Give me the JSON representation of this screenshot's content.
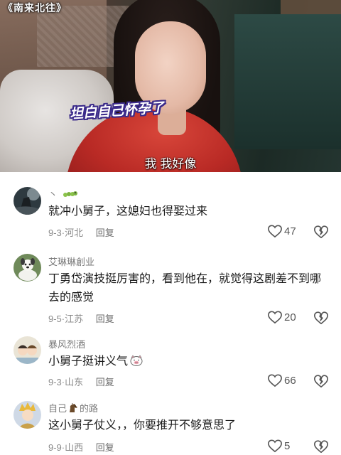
{
  "video": {
    "title_tag": "《南来北往》",
    "sticker_text": "坦白自己怀孕了",
    "subtitle": "我 我好像"
  },
  "comments": [
    {
      "nickname": "丶",
      "nickname_badge_icon": "caterpillar-icon",
      "text": "就冲小舅子，这媳妇也得娶过来",
      "date": "9-3",
      "location": "河北",
      "reply_label": "回复",
      "likes": "47"
    },
    {
      "nickname": "艾琳琳創业",
      "text": "丁勇岱演技挺厉害的，看到他在，就觉得这剧差不到哪去的感觉",
      "date": "9-5",
      "location": "江苏",
      "reply_label": "回复",
      "likes": "20"
    },
    {
      "nickname": "暴风烈酒",
      "text": "小舅子挺讲义气",
      "text_emoji_icon": "pig-face-icon",
      "date": "9-3",
      "location": "山东",
      "reply_label": "回复",
      "likes": "66"
    },
    {
      "nickname_prefix": "自己",
      "nickname_icon": "horse-icon",
      "nickname_suffix": "的路",
      "text": "这小舅子仗义，，你要推开不够意思了",
      "date": "9-9",
      "location": "山西",
      "reply_label": "回复",
      "likes": "5"
    }
  ],
  "colors": {
    "like_icon": "#555555",
    "meta_text": "#8a8a8a",
    "nickname_text": "#7a7a7a"
  }
}
